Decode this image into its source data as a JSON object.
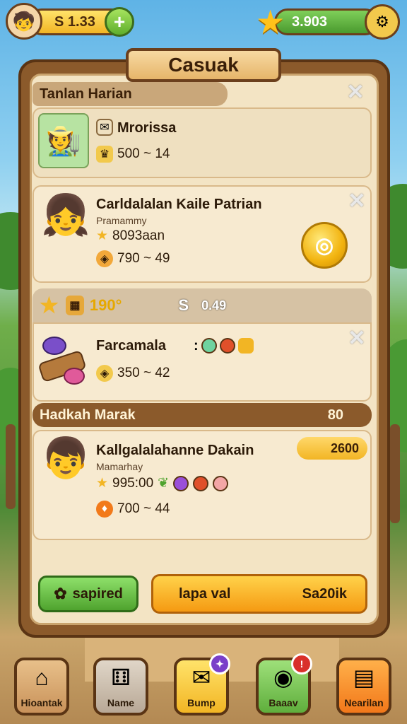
{
  "header": {
    "left_currency": "S 1.33",
    "right_currency": "3.903",
    "plus": "+"
  },
  "title": "Casuak",
  "sections": {
    "daily_header": "Tanlan Harian",
    "market_header": "Hadkah Marak",
    "market_count": "80"
  },
  "cards": [
    {
      "name": "Mrorissa",
      "value": "500 ~ 14"
    },
    {
      "name": "Carldalalan Kaile Patrian",
      "sub": "Pramammy",
      "line1": "8093aan",
      "line2": "790 ~ 49"
    },
    {
      "name": "Farcamala",
      "value": "350 ~ 42"
    },
    {
      "name": "Kallgalalahanne Dakain",
      "sub": "Mamarhay",
      "line1": "995:00",
      "line2": "700 ~ 44",
      "price": "2600"
    }
  ],
  "summary_bar": {
    "stat1": "190°",
    "stat2": "S",
    "stat3": "0.49"
  },
  "buttons": {
    "left": "sapired",
    "right_left": "lapa val",
    "right_right": "Sa20ik"
  },
  "nav": [
    {
      "label": "Hioantak",
      "icon": "home-icon"
    },
    {
      "label": "Name",
      "icon": "dice-icon"
    },
    {
      "label": "Bump",
      "icon": "envelope-icon"
    },
    {
      "label": "Baaav",
      "icon": "coins-icon"
    },
    {
      "label": "Nearilan",
      "icon": "card-icon"
    }
  ],
  "colors": {
    "panel_brown": "#8b5a2b",
    "gold": "#f2b524",
    "green": "#4fa32e",
    "orange": "#f59a12"
  }
}
